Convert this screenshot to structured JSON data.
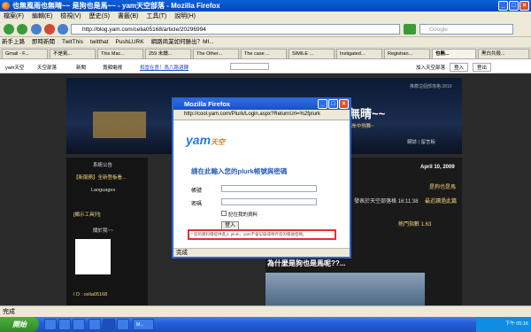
{
  "window": {
    "title": "也無風雨也無晴~~ 是狗也是馬~~ - yam天空部落 - Mozilla Firefox"
  },
  "menu": [
    "檔案(F)",
    "編輯(E)",
    "檢視(V)",
    "歷史(S)",
    "書籤(B)",
    "工具(T)",
    "說明(H)"
  ],
  "nav": {
    "url": "http://blog.yam.com/celia05168/article/20296994",
    "search_placeholder": "Google"
  },
  "bookmarks": [
    "新手上路",
    "即時新聞",
    "TwitThis",
    "twitthat",
    "PushLURK",
    "網路商業如何勝出？MI..."
  ],
  "tabs": [
    "Gmail - F...",
    "不是氣...",
    "This Mac...",
    "259 未讀...",
    "The Other...",
    "The case ...",
    "SIMILE ...",
    "Instigated...",
    "Registran...",
    "也無...",
    "黑白共殺..."
  ],
  "yamnav": {
    "items": [
      "yam天空",
      "天空部落",
      "新聞",
      "寬頻電視",
      "相當在意！馬六路週轉"
    ],
    "right": [
      "加入天空部落",
      "登入",
      "登出"
    ]
  },
  "blog": {
    "title": "飄雨也無晴~~",
    "subtitle": "...孤了滿鎮失舞子,就這樣在彼岸中飛舞~",
    "links": "網誌 | 留言板",
    "top_notice": "推薦這個部落格:2819",
    "sidebar": {
      "announce": "系統公告",
      "news": "【新服務】全新登板看...",
      "languages": "Languages",
      "tools": "[顯示工具列]",
      "related": "關於我~~",
      "id": "I D : celia05168"
    },
    "date": "April 10, 2009",
    "post_links": [
      "是狗也是馬",
      "發表於天空部落格 16:11:38",
      "最近讀過此篇"
    ],
    "article_title": "為什麼是狗也是馬呢??...",
    "rating": "熱門指數 1.63"
  },
  "dialog": {
    "title": "Mozilla Firefox",
    "url": "http://cool.yam.com/Plurk/Login.aspx?ReturnUrl=%2fplurk",
    "brand": "天空",
    "heading": "請在此輸入您的plurk帳號與密碼",
    "account_label": "帳號",
    "password_label": "密碼",
    "remember": "記住我的資料",
    "login": "登入",
    "notice": "* 您的資料僅提供進入 plurk，yam不會記錄或保存您的帳號密碼。",
    "status": "完成"
  },
  "status": {
    "text": "完成"
  },
  "taskbar": {
    "start": "開始",
    "tasks": [
      "",
      "",
      "",
      "",
      "",
      "",
      "M..."
    ],
    "clock": "下午 05:16"
  },
  "colors": {
    "accent": "#2b64d6",
    "alert": "#e53030"
  }
}
